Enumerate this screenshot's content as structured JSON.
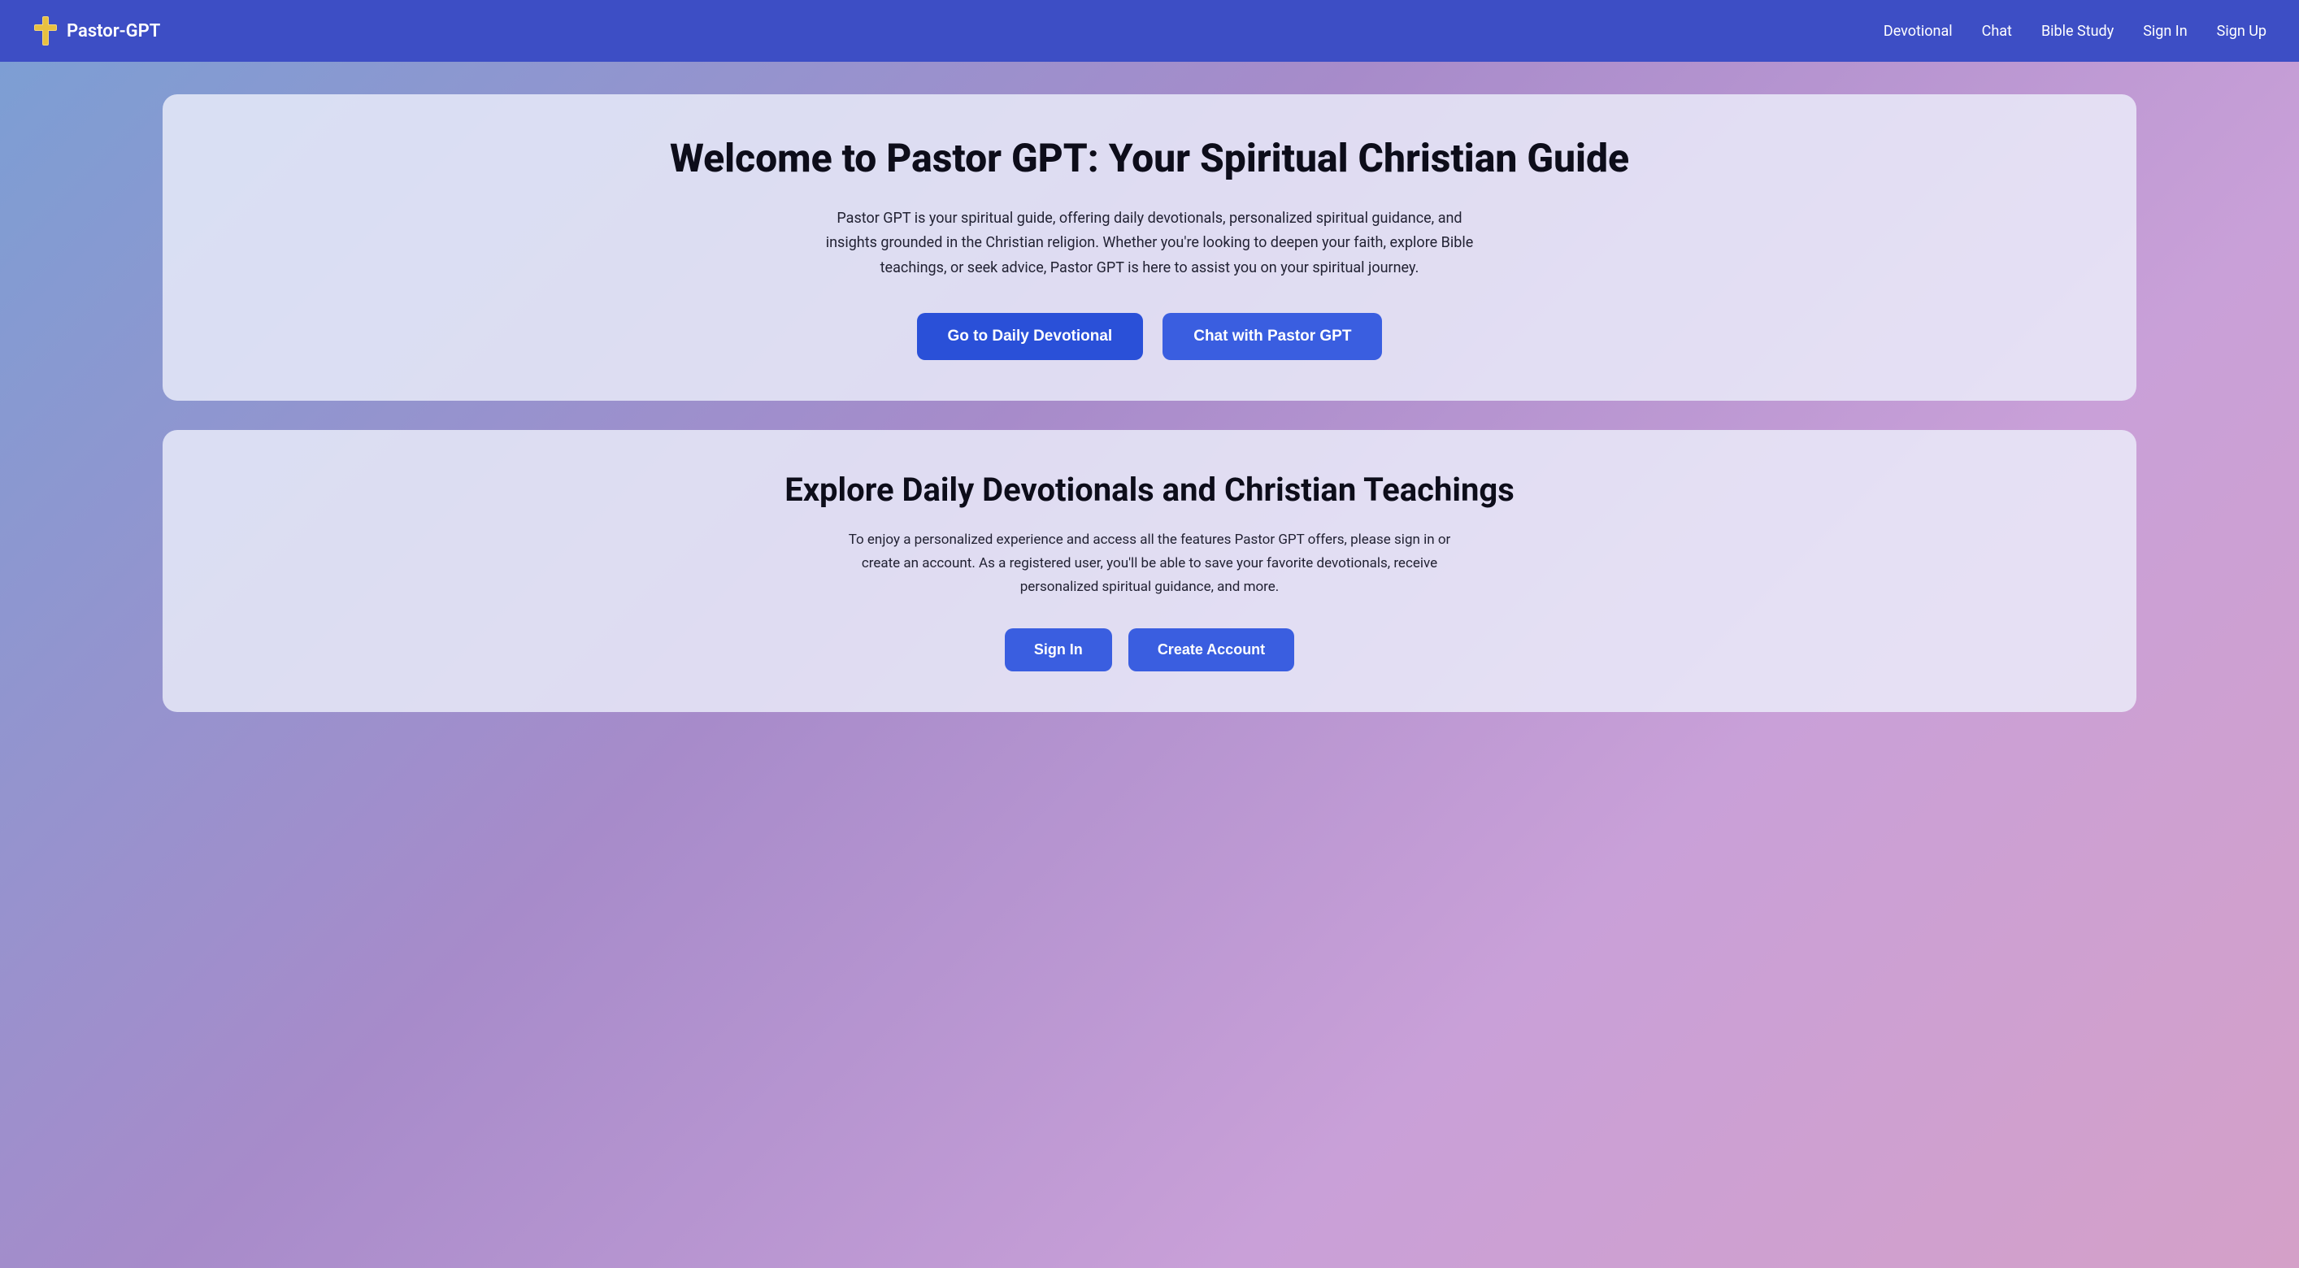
{
  "navbar": {
    "brand_label": "Pastor-GPT",
    "links": [
      {
        "id": "devotional",
        "label": "Devotional"
      },
      {
        "id": "chat",
        "label": "Chat"
      },
      {
        "id": "bible-study",
        "label": "Bible Study"
      },
      {
        "id": "sign-in",
        "label": "Sign In"
      },
      {
        "id": "sign-up",
        "label": "Sign Up"
      }
    ]
  },
  "hero": {
    "title": "Welcome to Pastor GPT: Your Spiritual Christian Guide",
    "description": "Pastor GPT is your spiritual guide, offering daily devotionals, personalized spiritual guidance, and insights grounded in the Christian religion. Whether you're looking to deepen your faith, explore Bible teachings, or seek advice, Pastor GPT is here to assist you on your spiritual journey.",
    "btn_devotional": "Go to Daily Devotional",
    "btn_chat": "Chat with Pastor GPT"
  },
  "devotionals": {
    "title": "Explore Daily Devotionals and Christian Teachings",
    "description": "To enjoy a personalized experience and access all the features Pastor GPT offers, please sign in or create an account. As a registered user, you'll be able to save your favorite devotionals, receive personalized spiritual guidance, and more.",
    "btn_signin": "Sign In",
    "btn_create": "Create Account"
  },
  "colors": {
    "navbar_bg": "#3d4ec5",
    "btn_primary": "#2a50d8",
    "btn_secondary": "#3a5ee0"
  }
}
